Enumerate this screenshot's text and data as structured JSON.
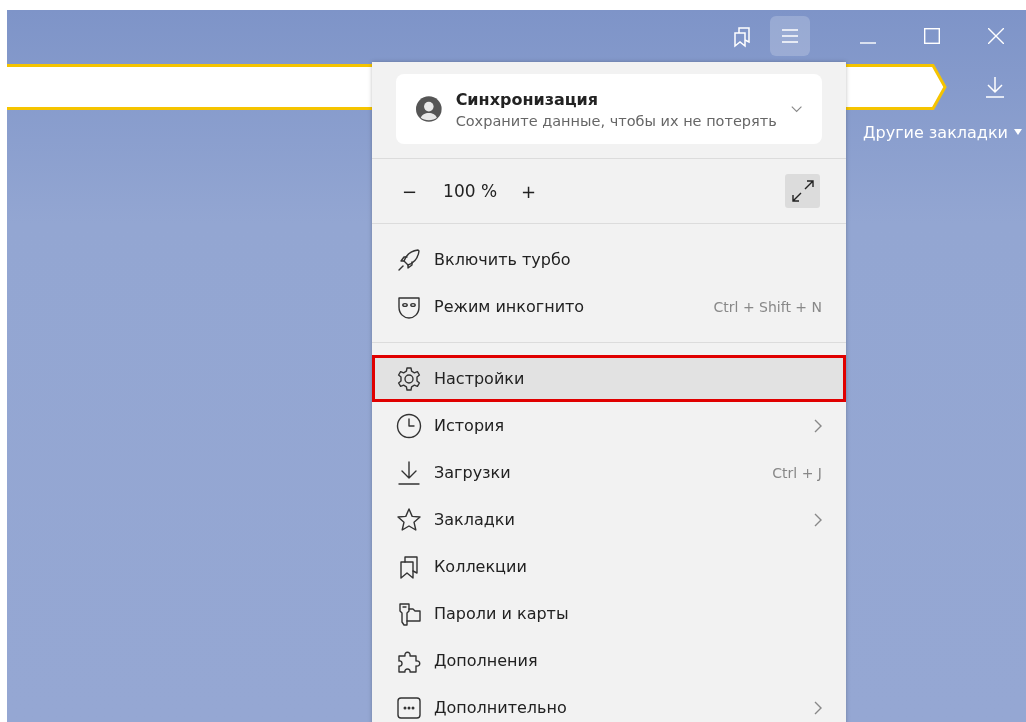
{
  "bookmarks_bar": {
    "other_bookmarks": "Другие закладки"
  },
  "menu": {
    "sync": {
      "title": "Синхронизация",
      "subtitle": "Сохраните данные, чтобы их не потерять"
    },
    "zoom": {
      "minus": "−",
      "value": "100 %",
      "plus": "+"
    },
    "sections": [
      [
        {
          "kind": "turbo",
          "label": "Включить турбо",
          "submenu": false,
          "selected": false
        },
        {
          "kind": "incognito",
          "label": "Режим инкогнито",
          "shortcut": "Ctrl + Shift + N",
          "submenu": false,
          "selected": false
        }
      ],
      [
        {
          "kind": "settings",
          "label": "Настройки",
          "submenu": false,
          "selected": true
        },
        {
          "kind": "history",
          "label": "История",
          "submenu": true,
          "selected": false
        },
        {
          "kind": "downloads",
          "label": "Загрузки",
          "shortcut": "Ctrl + J",
          "submenu": false,
          "selected": false
        },
        {
          "kind": "bookmarks",
          "label": "Закладки",
          "submenu": true,
          "selected": false
        },
        {
          "kind": "collections",
          "label": "Коллекции",
          "submenu": false,
          "selected": false
        },
        {
          "kind": "passwords",
          "label": "Пароли и карты",
          "submenu": false,
          "selected": false
        },
        {
          "kind": "extensions",
          "label": "Дополнения",
          "submenu": false,
          "selected": false
        },
        {
          "kind": "more",
          "label": "Дополнительно",
          "submenu": true,
          "selected": false
        }
      ]
    ]
  }
}
